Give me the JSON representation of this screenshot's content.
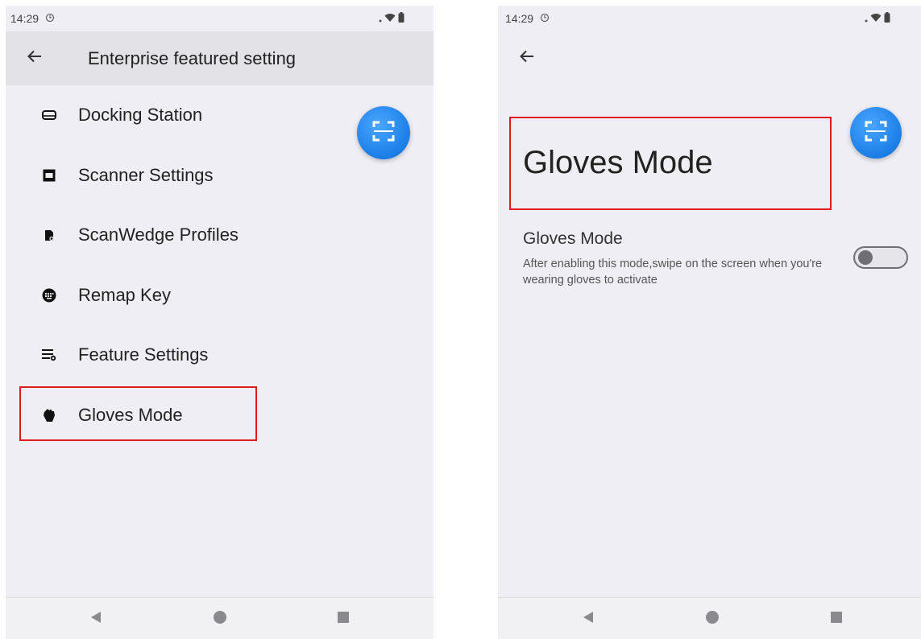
{
  "left_screen": {
    "status_bar": {
      "time": "14:29"
    },
    "appbar": {
      "title": "Enterprise featured setting"
    },
    "menu": [
      {
        "label": "Docking Station",
        "icon": "docking-station-icon"
      },
      {
        "label": "Scanner Settings",
        "icon": "scanner-icon"
      },
      {
        "label": "ScanWedge Profiles",
        "icon": "profile-document-icon"
      },
      {
        "label": "Remap Key",
        "icon": "keyboard-icon"
      },
      {
        "label": "Feature Settings",
        "icon": "feature-settings-icon"
      },
      {
        "label": "Gloves Mode",
        "icon": "glove-icon"
      }
    ]
  },
  "right_screen": {
    "status_bar": {
      "time": "14:29"
    },
    "page_title": "Gloves Mode",
    "preference": {
      "title": "Gloves Mode",
      "summary": "After enabling this mode,swipe on the screen when you're wearing gloves to activate",
      "enabled": false
    }
  },
  "colors": {
    "highlight": "#e01b1b",
    "fab": "#1b7ee6",
    "background": "#efeef4",
    "appbar": "#e3e2e6"
  }
}
